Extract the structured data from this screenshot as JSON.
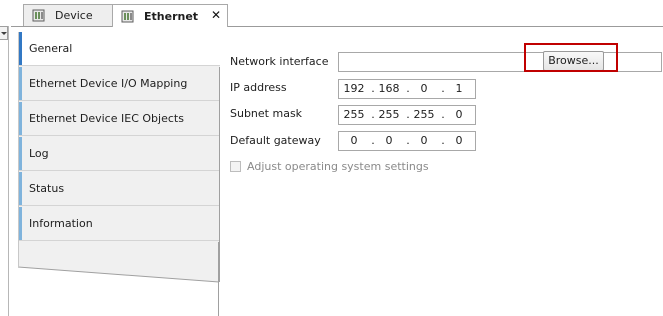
{
  "tabs": [
    {
      "label": "Device",
      "icon": "device-icon"
    },
    {
      "label": "Ethernet",
      "icon": "device-icon",
      "close": "✕"
    }
  ],
  "nav": [
    {
      "label": "General",
      "active": true
    },
    {
      "label": "Ethernet Device I/O Mapping"
    },
    {
      "label": "Ethernet Device IEC Objects"
    },
    {
      "label": "Log"
    },
    {
      "label": "Status"
    },
    {
      "label": "Information"
    }
  ],
  "form": {
    "network_interface": {
      "label": "Network interface",
      "value": "",
      "button": "Browse..."
    },
    "ip_address": {
      "label": "IP address",
      "octets": [
        "192",
        "168",
        "0",
        "1"
      ]
    },
    "subnet_mask": {
      "label": "Subnet mask",
      "octets": [
        "255",
        "255",
        "255",
        "0"
      ]
    },
    "default_gateway": {
      "label": "Default gateway",
      "octets": [
        "0",
        "0",
        "0",
        "0"
      ]
    },
    "adjust_os": {
      "label": "Adjust operating system settings",
      "checked": false,
      "enabled": false
    }
  },
  "colors": {
    "highlight": "#c00000",
    "nav_accent": "#7fb3dc",
    "nav_accent_active": "#3278c4"
  }
}
